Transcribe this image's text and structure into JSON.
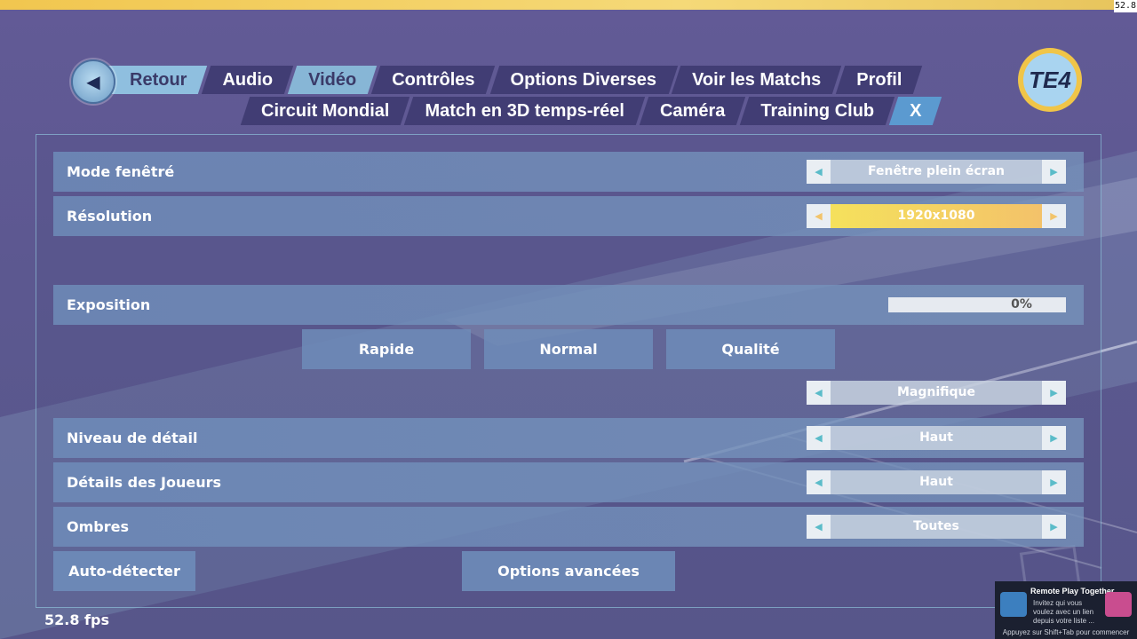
{
  "fps_corner": "52.8",
  "logo_text": "TE4",
  "nav": {
    "row1": [
      "Retour",
      "Audio",
      "Vidéo",
      "Contrôles",
      "Options Diverses",
      "Voir les Matchs",
      "Profil"
    ],
    "row2": [
      "Circuit Mondial",
      "Match en 3D temps-réel",
      "Caméra",
      "Training Club",
      "X"
    ]
  },
  "settings": {
    "mode_label": "Mode fenêtré",
    "mode_value": "Fenêtre plein écran",
    "resolution_label": "Résolution",
    "resolution_value": "1920x1080",
    "exposure_label": "Exposition",
    "exposure_value": "0%",
    "presets": [
      "Rapide",
      "Normal",
      "Qualité"
    ],
    "quality_value": "Magnifique",
    "detail_label": "Niveau de détail",
    "detail_value": "Haut",
    "players_label": "Détails des Joueurs",
    "players_value": "Haut",
    "shadows_label": "Ombres",
    "shadows_value": "Toutes"
  },
  "buttons": {
    "autodetect": "Auto-détecter",
    "advanced": "Options avancées"
  },
  "fps_label": "52.8 fps",
  "remote_play": {
    "title": "Remote Play Together",
    "description": "Invitez qui vous voulez avec un lien depuis votre liste ...",
    "hint": "Appuyez sur Shift+Tab pour commencer"
  }
}
